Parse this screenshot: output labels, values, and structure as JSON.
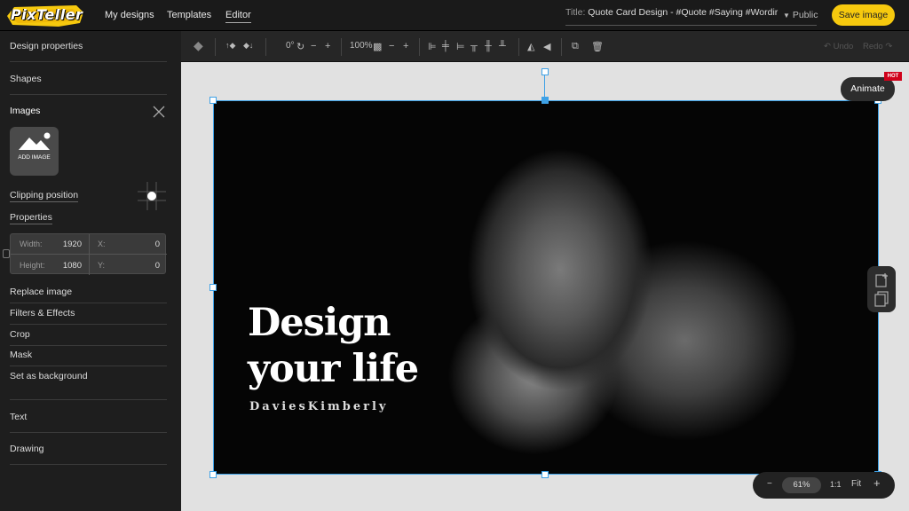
{
  "app": {
    "logo": "PixTeller"
  },
  "nav": [
    {
      "label": "My designs"
    },
    {
      "label": "Templates"
    },
    {
      "label": "Editor"
    }
  ],
  "title": {
    "label": "Title:",
    "value": "Quote Card Design - #Quote #Saying #Wordir"
  },
  "visibility": "Public",
  "save_label": "Save image",
  "sidebar": {
    "sections": [
      "Design properties",
      "Shapes",
      "Images"
    ],
    "add_image": "ADD IMAGE",
    "clipping": "Clipping position",
    "properties": "Properties",
    "width_label": "Width:",
    "width_value": "1920",
    "height_label": "Height:",
    "height_value": "1080",
    "x_label": "X:",
    "x_value": "0",
    "y_label": "Y:",
    "y_value": "0",
    "actions": [
      "Replace image",
      "Filters & Effects",
      "Crop",
      "Mask",
      "Set as background"
    ],
    "bottom": [
      "Text",
      "Drawing"
    ]
  },
  "toolbar": {
    "rotation": "0°",
    "opacity": "100%",
    "undo": "Undo",
    "redo": "Redo"
  },
  "canvas": {
    "title_line1": "Design",
    "title_line2": "your life",
    "author": "DaviesKimberly",
    "animate": "Animate",
    "hot": "HOT"
  },
  "zoom": {
    "value": "61%",
    "one_to_one": "1:1",
    "fit": "Fit"
  },
  "colors": {
    "accent": "#f6c90e",
    "selection": "#3ea1e6",
    "hot": "#d0021b"
  }
}
